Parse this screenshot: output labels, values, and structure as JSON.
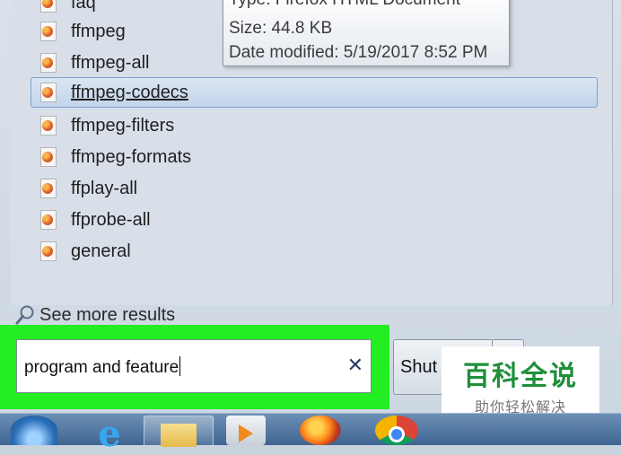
{
  "results": [
    {
      "name": "faq",
      "selected": false
    },
    {
      "name": "ffmpeg",
      "selected": false
    },
    {
      "name": "ffmpeg-all",
      "selected": false
    },
    {
      "name": "ffmpeg-codecs",
      "selected": true
    },
    {
      "name": "ffmpeg-filters",
      "selected": false
    },
    {
      "name": "ffmpeg-formats",
      "selected": false
    },
    {
      "name": "ffplay-all",
      "selected": false
    },
    {
      "name": "ffprobe-all",
      "selected": false
    },
    {
      "name": "general",
      "selected": false
    }
  ],
  "tooltip": {
    "type_line": "Type: Firefox HTML Document",
    "size_line": "Size: 44.8 KB",
    "date_line": "Date modified: 5/19/2017 8:52 PM"
  },
  "see_more_label": "See more results",
  "search": {
    "value": "program and feature",
    "clear_symbol": "✕"
  },
  "shutdown_label": "Shut d",
  "watermark": {
    "top": "百科全说",
    "bottom": "助你轻松解决"
  },
  "taskbar": {
    "ie_glyph": "e"
  },
  "icons": {
    "file": "firefox-html-file-icon",
    "search": "magnifier-icon",
    "clear": "close-icon"
  },
  "colors": {
    "highlight_green": "#22ee22",
    "selection": "#c3d4ea"
  }
}
